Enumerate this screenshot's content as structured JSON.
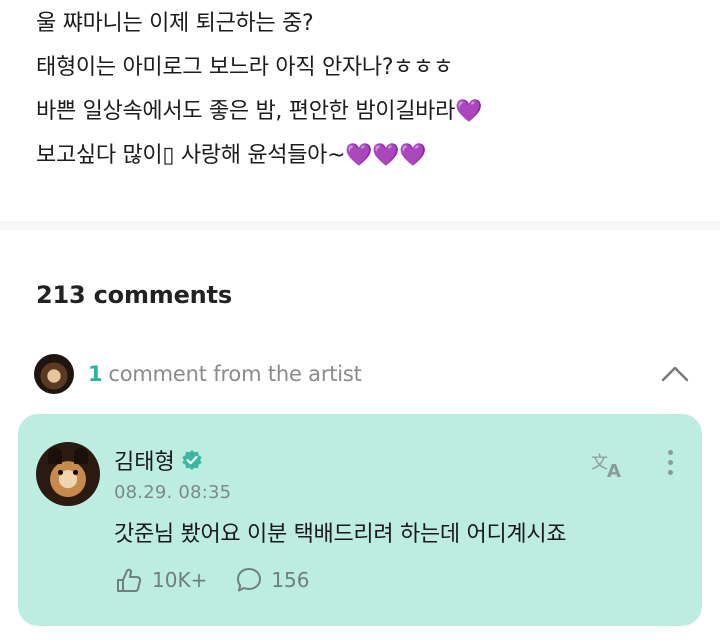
{
  "post": {
    "lines": [
      "울 쨔마니는 이제 퇴근하는 중?",
      "태형이는 아미로그 보느라 아직 안자나?ㅎㅎㅎ",
      "바쁜 일상속에서도 좋은 밤, 편안한 밤이길바라",
      "보고싶다 많이▯ 사랑해 윤석들아~"
    ],
    "line3_hearts": "💜",
    "line4_hearts": "💜💜💜"
  },
  "comments": {
    "count_label": "213 comments"
  },
  "artist_section": {
    "count": "1",
    "label": "comment from the artist"
  },
  "artist_comment": {
    "author": "김태형",
    "timestamp": "08.29. 08:35",
    "text": "갓준님 봤어요 이분 택배드리려 하는데 어디계시죠",
    "likes": "10K+",
    "replies": "156"
  },
  "icons": {
    "collapse": "chevron-up-icon",
    "verified": "verified-badge-icon",
    "translate": "translate-icon",
    "more": "more-vertical-icon",
    "like": "like-icon",
    "reply": "reply-icon"
  },
  "colors": {
    "accent": "#2bb59a",
    "card_bg": "#bdece0",
    "heart": "#9b3fd6",
    "verified": "#3ab8a0"
  }
}
